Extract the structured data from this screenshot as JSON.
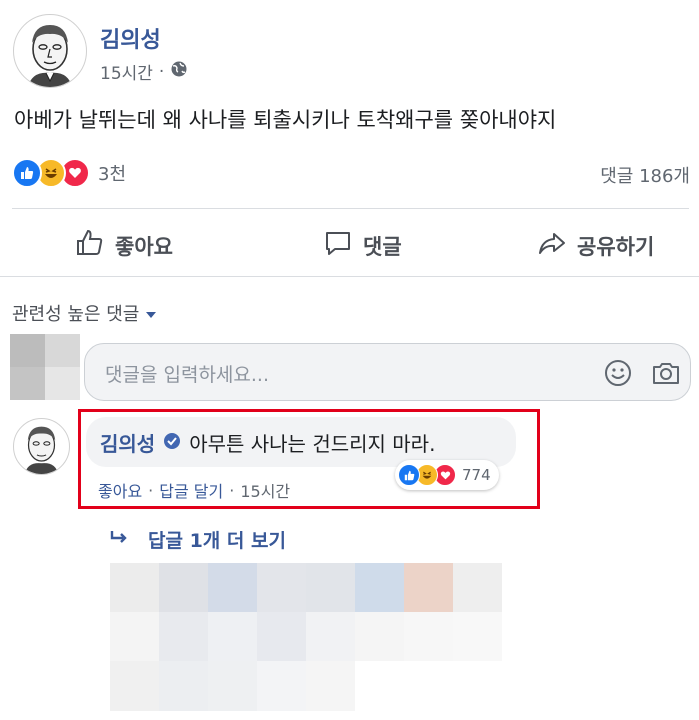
{
  "post": {
    "author": "김의성",
    "time": "15시간",
    "privacy_icon": "globe-icon",
    "text": "아베가 날뛰는데 왜 사나를 퇴출시키나 토착왜구를 쫒아내야지",
    "reaction_count": "3천",
    "reaction_icons": [
      "like-icon",
      "haha-icon",
      "love-icon"
    ],
    "comment_count": "댓글 186개"
  },
  "actions": {
    "like": "좋아요",
    "comment": "댓글",
    "share": "공유하기"
  },
  "comments_section": {
    "sort_label": "관련성 높은 댓글",
    "input_placeholder": "댓글을 입력하세요..."
  },
  "comment": {
    "author": "김의성",
    "verified_icon": "verified-badge-icon",
    "text": "아무튼 사나는 건드리지 마라.",
    "reaction_count": "774",
    "like": "좋아요",
    "reply": "답글 달기",
    "time": "15시간",
    "more_replies": "답글 1개 더 보기"
  },
  "colors": {
    "facebook_blue": "#385898",
    "highlight_red": "#e2001a",
    "like_blue": "#1877f2",
    "love_red": "#f0284a",
    "haha_yellow": "#f7b928"
  }
}
